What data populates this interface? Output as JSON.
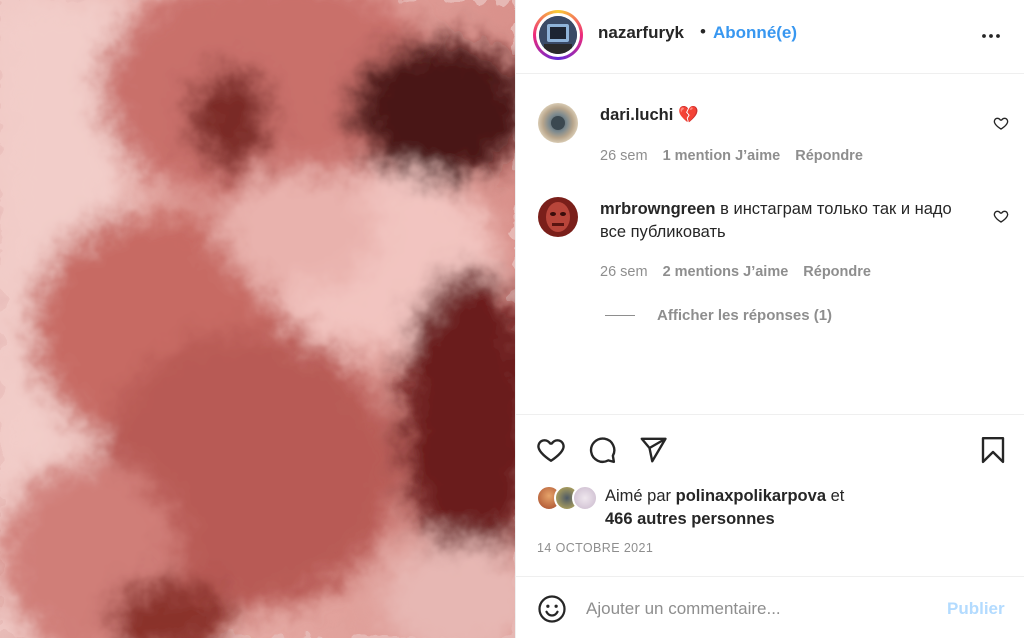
{
  "post": {
    "author": "nazarfuryk",
    "separator": "•",
    "follow_label": "Abonné(e)"
  },
  "comments": [
    {
      "username": "dari.luchi",
      "text": "💔",
      "time": "26 sem",
      "likes": "1 mention J’aime",
      "reply_label": "Répondre"
    },
    {
      "username": "mrbrowngreen",
      "text": "в инстаграм только так и надо все публиковать",
      "time": "26 sem",
      "likes": "2 mentions J’aime",
      "reply_label": "Répondre",
      "view_replies": "Afficher les réponses (1)"
    }
  ],
  "likes": {
    "prefix": "Aimé par",
    "user": "polinaxpolikarpova",
    "and": "et",
    "others": "466 autres personnes"
  },
  "date": "14 OCTOBRE 2021",
  "add_comment": {
    "placeholder": "Ajouter un commentaire...",
    "publish_label": "Publier"
  },
  "icons": {
    "like": "heart-icon",
    "comment": "comment-bubble-icon",
    "share": "paper-plane-icon",
    "save": "bookmark-icon",
    "more": "more-options-icon",
    "emoji": "emoji-icon"
  },
  "colors": {
    "link": "#3897f0",
    "muted": "#8e8e8e",
    "text": "#262626",
    "publish_disabled": "#b3dbff"
  }
}
